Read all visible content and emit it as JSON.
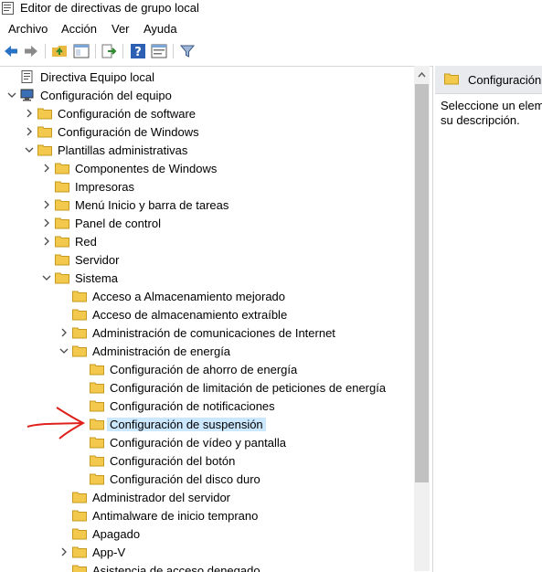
{
  "window": {
    "title": "Editor de directivas de grupo local"
  },
  "menu": [
    "Archivo",
    "Acción",
    "Ver",
    "Ayuda"
  ],
  "toolbar": [
    {
      "name": "back-icon"
    },
    {
      "name": "forward-icon"
    },
    {
      "name": "up-folder-icon"
    },
    {
      "name": "show-hide-tree-icon"
    },
    {
      "name": "export-list-icon"
    },
    {
      "name": "help-icon"
    },
    {
      "name": "properties-icon"
    },
    {
      "name": "filter-icon"
    }
  ],
  "tree": [
    {
      "label": "Directiva Equipo local",
      "level": 0,
      "expander": "none",
      "icon": "policy"
    },
    {
      "label": "Configuración del equipo",
      "level": 0,
      "expander": "open",
      "icon": "computer"
    },
    {
      "label": "Configuración de software",
      "level": 1,
      "expander": "closed",
      "icon": "folder"
    },
    {
      "label": "Configuración de Windows",
      "level": 1,
      "expander": "closed",
      "icon": "folder"
    },
    {
      "label": "Plantillas administrativas",
      "level": 1,
      "expander": "open",
      "icon": "folder"
    },
    {
      "label": "Componentes de Windows",
      "level": 2,
      "expander": "closed",
      "icon": "folder"
    },
    {
      "label": "Impresoras",
      "level": 2,
      "expander": "none",
      "icon": "folder"
    },
    {
      "label": "Menú Inicio y barra de tareas",
      "level": 2,
      "expander": "closed",
      "icon": "folder"
    },
    {
      "label": "Panel de control",
      "level": 2,
      "expander": "closed",
      "icon": "folder"
    },
    {
      "label": "Red",
      "level": 2,
      "expander": "closed",
      "icon": "folder"
    },
    {
      "label": "Servidor",
      "level": 2,
      "expander": "none",
      "icon": "folder"
    },
    {
      "label": "Sistema",
      "level": 2,
      "expander": "open",
      "icon": "folder"
    },
    {
      "label": "Acceso a Almacenamiento mejorado",
      "level": 3,
      "expander": "none",
      "icon": "folder"
    },
    {
      "label": "Acceso de almacenamiento extraíble",
      "level": 3,
      "expander": "none",
      "icon": "folder"
    },
    {
      "label": "Administración de comunicaciones de Internet",
      "level": 3,
      "expander": "closed",
      "icon": "folder"
    },
    {
      "label": "Administración de energía",
      "level": 3,
      "expander": "open",
      "icon": "folder"
    },
    {
      "label": "Configuración de ahorro de energía",
      "level": 4,
      "expander": "none",
      "icon": "folder"
    },
    {
      "label": "Configuración de limitación de peticiones de energía",
      "level": 4,
      "expander": "none",
      "icon": "folder"
    },
    {
      "label": "Configuración de notificaciones",
      "level": 4,
      "expander": "none",
      "icon": "folder"
    },
    {
      "label": "Configuración de suspensión",
      "level": 4,
      "expander": "none",
      "icon": "folder",
      "selected": true
    },
    {
      "label": "Configuración de vídeo y pantalla",
      "level": 4,
      "expander": "none",
      "icon": "folder"
    },
    {
      "label": "Configuración del botón",
      "level": 4,
      "expander": "none",
      "icon": "folder"
    },
    {
      "label": "Configuración del disco duro",
      "level": 4,
      "expander": "none",
      "icon": "folder"
    },
    {
      "label": "Administrador del servidor",
      "level": 3,
      "expander": "none",
      "icon": "folder"
    },
    {
      "label": "Antimalware de inicio temprano",
      "level": 3,
      "expander": "none",
      "icon": "folder"
    },
    {
      "label": "Apagado",
      "level": 3,
      "expander": "none",
      "icon": "folder"
    },
    {
      "label": "App-V",
      "level": 3,
      "expander": "closed",
      "icon": "folder"
    },
    {
      "label": "Asistencia de acceso denegado",
      "level": 3,
      "expander": "none",
      "icon": "folder"
    }
  ],
  "right_pane": {
    "header": "Configuración",
    "description_line1": "Seleccione un elem",
    "description_line2": "su descripción."
  },
  "colors": {
    "selection": "#cce8ff",
    "folder": "#f2c94c",
    "annotation": "#e0201b"
  }
}
